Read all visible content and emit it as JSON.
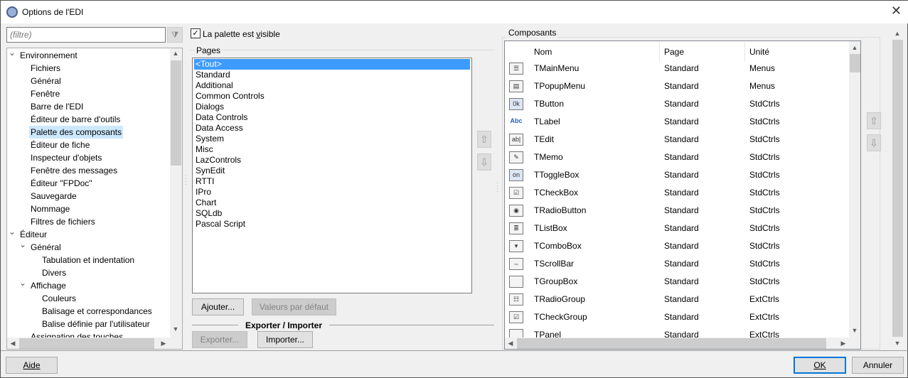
{
  "window": {
    "title": "Options de l'EDI",
    "close": "✕"
  },
  "filter": {
    "placeholder": "(filtre)"
  },
  "tree": [
    {
      "label": "Environnement",
      "level": 0,
      "expander": "⌄"
    },
    {
      "label": "Fichiers",
      "level": 1
    },
    {
      "label": "Général",
      "level": 1
    },
    {
      "label": "Fenêtre",
      "level": 1
    },
    {
      "label": "Barre de l'EDI",
      "level": 1
    },
    {
      "label": "Éditeur de barre d'outils",
      "level": 1
    },
    {
      "label": "Palette des composants",
      "level": 1,
      "selected": true
    },
    {
      "label": "Éditeur de fiche",
      "level": 1
    },
    {
      "label": "Inspecteur d'objets",
      "level": 1
    },
    {
      "label": "Fenêtre des messages",
      "level": 1
    },
    {
      "label": "Éditeur \"FPDoc\"",
      "level": 1
    },
    {
      "label": "Sauvegarde",
      "level": 1
    },
    {
      "label": "Nommage",
      "level": 1
    },
    {
      "label": "Filtres de fichiers",
      "level": 1
    },
    {
      "label": "Éditeur",
      "level": 0,
      "expander": "⌄"
    },
    {
      "label": "Général",
      "level": 1,
      "expander": "⌄"
    },
    {
      "label": "Tabulation et indentation",
      "level": 2
    },
    {
      "label": "Divers",
      "level": 2
    },
    {
      "label": "Affichage",
      "level": 1,
      "expander": "⌄"
    },
    {
      "label": "Couleurs",
      "level": 2
    },
    {
      "label": "Balisage et correspondances",
      "level": 2
    },
    {
      "label": "Balise définie par l'utilisateur",
      "level": 2
    },
    {
      "label": "Assignation des touches",
      "level": 1
    }
  ],
  "palette_visible": {
    "label_pre": "La palette est ",
    "label_u": "v",
    "label_post": "isible",
    "checked": true
  },
  "pages": {
    "label": "Pages",
    "items": [
      "<Tout>",
      "Standard",
      "Additional",
      "Common Controls",
      "Dialogs",
      "Data Controls",
      "Data Access",
      "System",
      "Misc",
      "LazControls",
      "SynEdit",
      "RTTI",
      "IPro",
      "Chart",
      "SQLdb",
      "Pascal Script"
    ],
    "selected": 0
  },
  "buttons": {
    "add": "Ajouter...",
    "defaults": "Valeurs par défaut",
    "export": "Exporter...",
    "import": "Importer...",
    "help": "Aide",
    "ok": "OK",
    "cancel": "Annuler",
    "up": "⇧",
    "down": "⇩"
  },
  "export_import_label": "Exporter / Importer",
  "components": {
    "label": "Composants",
    "columns": [
      "Nom",
      "Page",
      "Unité"
    ],
    "rows": [
      {
        "icon": "main-menu",
        "glyph": "☰",
        "name": "TMainMenu",
        "page": "Standard",
        "unit": "Menus"
      },
      {
        "icon": "popup-menu",
        "glyph": "▤",
        "name": "TPopupMenu",
        "page": "Standard",
        "unit": "Menus"
      },
      {
        "icon": "button",
        "glyph": "0k",
        "name": "TButton",
        "page": "Standard",
        "unit": "StdCtrls"
      },
      {
        "icon": "label",
        "glyph": "Abc",
        "name": "TLabel",
        "page": "Standard",
        "unit": "StdCtrls"
      },
      {
        "icon": "edit",
        "glyph": "ab|",
        "name": "TEdit",
        "page": "Standard",
        "unit": "StdCtrls"
      },
      {
        "icon": "memo",
        "glyph": "✎",
        "name": "TMemo",
        "page": "Standard",
        "unit": "StdCtrls"
      },
      {
        "icon": "toggle-box",
        "glyph": "on",
        "name": "TToggleBox",
        "page": "Standard",
        "unit": "StdCtrls"
      },
      {
        "icon": "checkbox",
        "glyph": "☑",
        "name": "TCheckBox",
        "page": "Standard",
        "unit": "StdCtrls"
      },
      {
        "icon": "radio-button",
        "glyph": "◉",
        "name": "TRadioButton",
        "page": "Standard",
        "unit": "StdCtrls"
      },
      {
        "icon": "listbox",
        "glyph": "≣",
        "name": "TListBox",
        "page": "Standard",
        "unit": "StdCtrls"
      },
      {
        "icon": "combobox",
        "glyph": "▾",
        "name": "TComboBox",
        "page": "Standard",
        "unit": "StdCtrls"
      },
      {
        "icon": "scrollbar",
        "glyph": "⇔",
        "name": "TScrollBar",
        "page": "Standard",
        "unit": "StdCtrls"
      },
      {
        "icon": "groupbox",
        "glyph": "",
        "name": "TGroupBox",
        "page": "Standard",
        "unit": "StdCtrls"
      },
      {
        "icon": "radio-group",
        "glyph": "☷",
        "name": "TRadioGroup",
        "page": "Standard",
        "unit": "ExtCtrls"
      },
      {
        "icon": "check-group",
        "glyph": "☑",
        "name": "TCheckGroup",
        "page": "Standard",
        "unit": "ExtCtrls"
      },
      {
        "icon": "panel",
        "glyph": "",
        "name": "TPanel",
        "page": "Standard",
        "unit": "ExtCtrls"
      }
    ]
  }
}
